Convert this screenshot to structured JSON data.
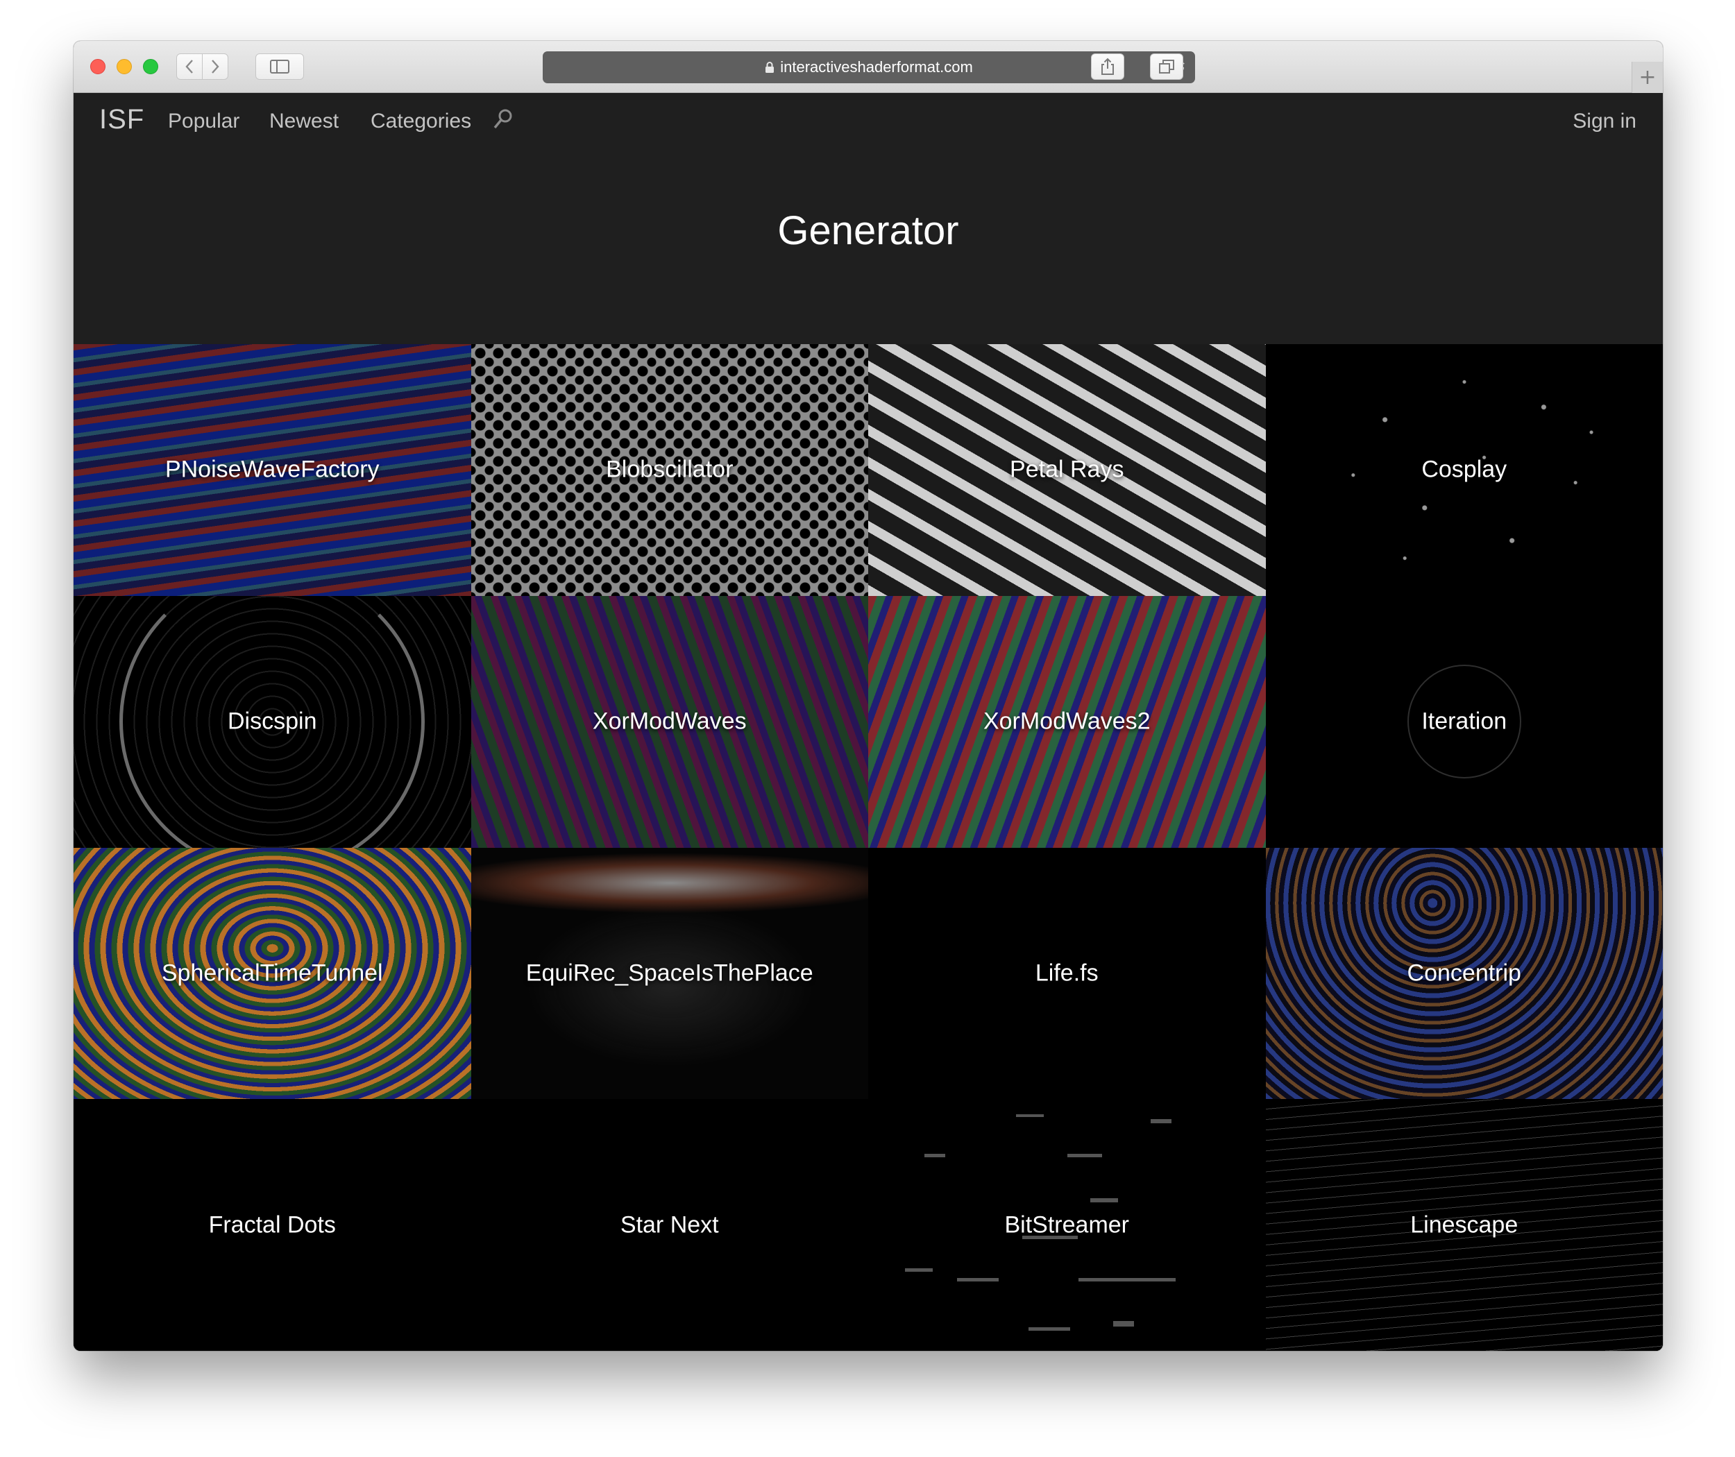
{
  "browser": {
    "url": "interactiveshaderformat.com"
  },
  "nav": {
    "logo": "ISF",
    "links": [
      "Popular",
      "Newest",
      "Categories"
    ],
    "signin": "Sign in"
  },
  "page": {
    "title": "Generator"
  },
  "shaders": [
    {
      "name": "PNoiseWaveFactory"
    },
    {
      "name": "Blobscillator"
    },
    {
      "name": "Petal Rays"
    },
    {
      "name": "Cosplay"
    },
    {
      "name": "Discspin"
    },
    {
      "name": "XorModWaves"
    },
    {
      "name": "XorModWaves2"
    },
    {
      "name": "Iteration"
    },
    {
      "name": "SphericalTimeTunnel"
    },
    {
      "name": "EquiRec_SpaceIsThePlace"
    },
    {
      "name": "Life.fs"
    },
    {
      "name": "Concentrip"
    },
    {
      "name": "Fractal Dots"
    },
    {
      "name": "Star Next"
    },
    {
      "name": "BitStreamer"
    },
    {
      "name": "Linescape"
    }
  ]
}
